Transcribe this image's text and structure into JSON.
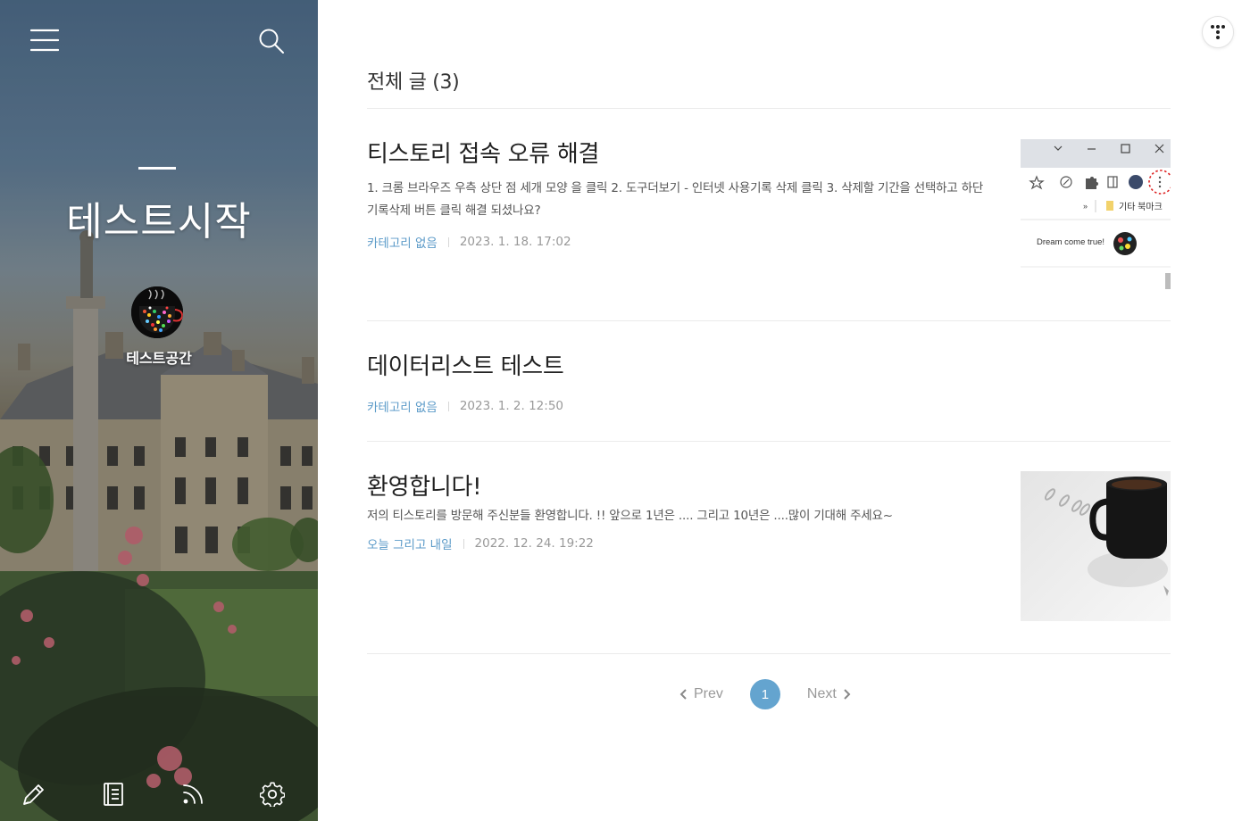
{
  "sidebar": {
    "blog_title": "테스트시작",
    "blog_name": "테스트공간",
    "icons": {
      "menu": "hamburger-menu-icon",
      "search": "search-icon",
      "write": "pencil-icon",
      "manage": "notebook-icon",
      "rss": "rss-icon",
      "settings": "gear-icon"
    }
  },
  "main": {
    "list_title": "전체 글 (3)",
    "posts": [
      {
        "title": "티스토리 접속 오류 해결",
        "excerpt": "1. 크롬 브라우즈 우측 상단 점 세개 모양 을 클릭 2. 도구더보기 - 인터넷 사용기록 삭제 클릭 3. 삭제할 기간을 선택하고 하단 기록삭제 버튼 클릭 해결 되셨나요?",
        "category": "카테고리 없음",
        "date": "2023. 1. 18. 17:02",
        "thumb": {
          "bookmark_label": "기타 북마크",
          "profile_text": "Dream come true!"
        }
      },
      {
        "title": "데이터리스트 테스트",
        "excerpt": "",
        "category": "카테고리 없음",
        "date": "2023. 1. 2. 12:50"
      },
      {
        "title": "환영합니다!",
        "excerpt": "저의 티스토리를 방문해 주신분들 환영합니다. !! 앞으로 1년은 .... 그리고 10년은 ....많이 기대해 주세요~",
        "category": "오늘 그리고 내일",
        "date": "2022. 12. 24. 19:22"
      }
    ]
  },
  "pagination": {
    "prev": "Prev",
    "current": "1",
    "next": "Next"
  },
  "colors": {
    "accent": "#64a4cf",
    "category_link": "#5b9ac8",
    "date": "#999999"
  }
}
